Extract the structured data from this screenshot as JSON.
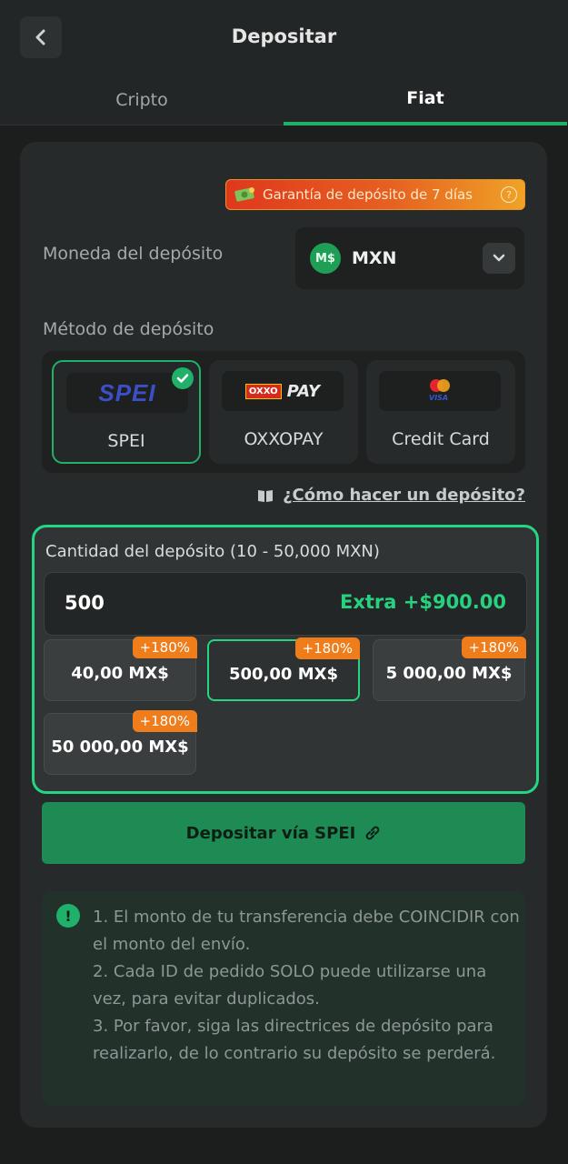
{
  "header": {
    "title": "Depositar",
    "back_icon": "chevron-left-icon"
  },
  "tabs": [
    {
      "label": "Cripto",
      "active": false
    },
    {
      "label": "Fiat",
      "active": true
    }
  ],
  "guarantee_badge": {
    "text": "Garantía de depósito de 7 días",
    "icon": "money-icon",
    "help_icon": "?"
  },
  "currency": {
    "label": "Moneda del depósito",
    "icon_text": "M$",
    "code": "MXN"
  },
  "method": {
    "label": "Método de depósito",
    "options": [
      {
        "label": "SPEI",
        "logo": "SPEI",
        "selected": true
      },
      {
        "label": "OXXOPAY",
        "logo_oxxo": "OXXO",
        "logo_pay": "PAY",
        "selected": false
      },
      {
        "label": "Credit Card",
        "logo": "VISA",
        "selected": false
      }
    ]
  },
  "howto": {
    "text": "¿Cómo hacer un depósito?"
  },
  "amount": {
    "title": "Cantidad del depósito (10 - 50,000 MXN)",
    "value": "500",
    "extra": "Extra +$900.00",
    "presets": [
      {
        "amount": "40,00 MX$",
        "bonus": "+180%",
        "selected": false
      },
      {
        "amount": "500,00 MX$",
        "bonus": "+180%",
        "selected": true
      },
      {
        "amount": "5 000,00 MX$",
        "bonus": "+180%",
        "selected": false
      },
      {
        "amount": "50 000,00 MX$",
        "bonus": "+180%",
        "selected": false
      }
    ]
  },
  "deposit_button": {
    "label": "Depositar vía SPEI"
  },
  "notice": {
    "icon": "!",
    "lines": [
      "1. El monto de tu transferencia debe COINCIDIR con el monto del envío.",
      "2. Cada ID de pedido SOLO puede utilizarse una vez, para evitar duplicados.",
      "3. Por favor, siga las directrices de depósito para realizarlo, de lo contrario su depósito se perderá."
    ]
  },
  "colors": {
    "accent": "#1fb16a",
    "highlight_border": "#24d684",
    "badge_orange": "#ef7d1c",
    "button_green": "#1e8b55"
  }
}
